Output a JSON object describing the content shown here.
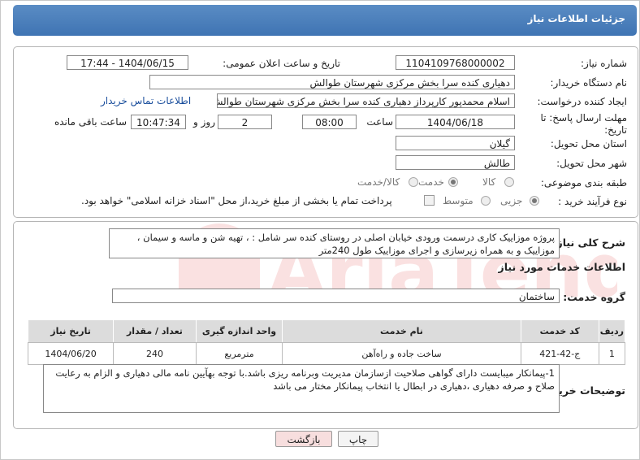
{
  "header": {
    "title": "جزئیات اطلاعات نیاز"
  },
  "form": {
    "need_number_label": "شماره نیاز:",
    "need_number": "1104109768000002",
    "announce_label": "تاریخ و ساعت اعلان عمومی:",
    "announce_value": "1404/06/15 - 17:44",
    "buyer_org_label": "نام دستگاه خریدار:",
    "buyer_org": "دهیاری کنده سرا بخش مرکزی شهرستان طوالش",
    "creator_label": "ایجاد کننده درخواست:",
    "creator": "اسلام محمدپور کارپرداز دهیاری کنده سرا بخش مرکزی شهرستان طوالش",
    "contact_link": "اطلاعات تماس خریدار",
    "deadline_label_1": "مهلت ارسال پاسخ: تا",
    "deadline_label_2": "تاریخ:",
    "deadline_date": "1404/06/18",
    "time_label": "ساعت",
    "deadline_time": "08:00",
    "days_value": "2",
    "days_label": "روز و",
    "remaining_time": "10:47:34",
    "remaining_label": "ساعت باقی مانده",
    "province_label": "استان محل تحویل:",
    "province": "گیلان",
    "city_label": "شهر محل تحویل:",
    "city": "طالش",
    "category_label": "طبقه بندی موضوعی:",
    "category_options": [
      "کالا",
      "خدمت",
      "کالا/خدمت"
    ],
    "category_selected": "خدمت",
    "process_label": "نوع فرآیند خرید :",
    "process_options": [
      "جزیی",
      "متوسط"
    ],
    "process_selected": "جزیی",
    "payment_note": "پرداخت تمام یا بخشی از مبلغ خرید،از محل \"اسناد خزانه اسلامی\" خواهد بود."
  },
  "description": {
    "label": "شرح کلی نیاز:",
    "text": "پروژه موزاییک کاری درسمت ورودی خیابان اصلی در روستای کنده سر شامل : ، تهیه شن و ماسه و سیمان ، موزاییک  و به همراه زیرسازی و اجرای موزاییک طول  240متر"
  },
  "services": {
    "section_title": "اطلاعات خدمات مورد نیاز",
    "group_label": "گروه خدمت:",
    "group_value": "ساختمان",
    "columns": [
      "ردیف",
      "کد خدمت",
      "نام خدمت",
      "واحد اندازه گیری",
      "تعداد / مقدار",
      "تاریخ نیاز"
    ],
    "rows": [
      [
        "1",
        "ج-42-421",
        "ساخت جاده و راه‌آهن",
        "مترمربع",
        "240",
        "1404/06/20"
      ]
    ]
  },
  "buyer_notes": {
    "label": "توضیحات خریدار:",
    "text": "1-پیمانکار میبایست دارای گواهی صلاحیت ازسازمان مدیریت وبرنامه ریزی باشد.با توجه بهآیین نامه مالی دهیاری و الزام به رعایت صلاح و صرفه دهیاری ،دهیاری در ابطال یا انتخاب پیمانکار مختار می باشد"
  },
  "buttons": {
    "print": "چاپ",
    "back": "بازگشت"
  },
  "colors": {
    "header": "#4a7fbf",
    "link": "#1a4e9c",
    "back_button": "#f7dede"
  }
}
